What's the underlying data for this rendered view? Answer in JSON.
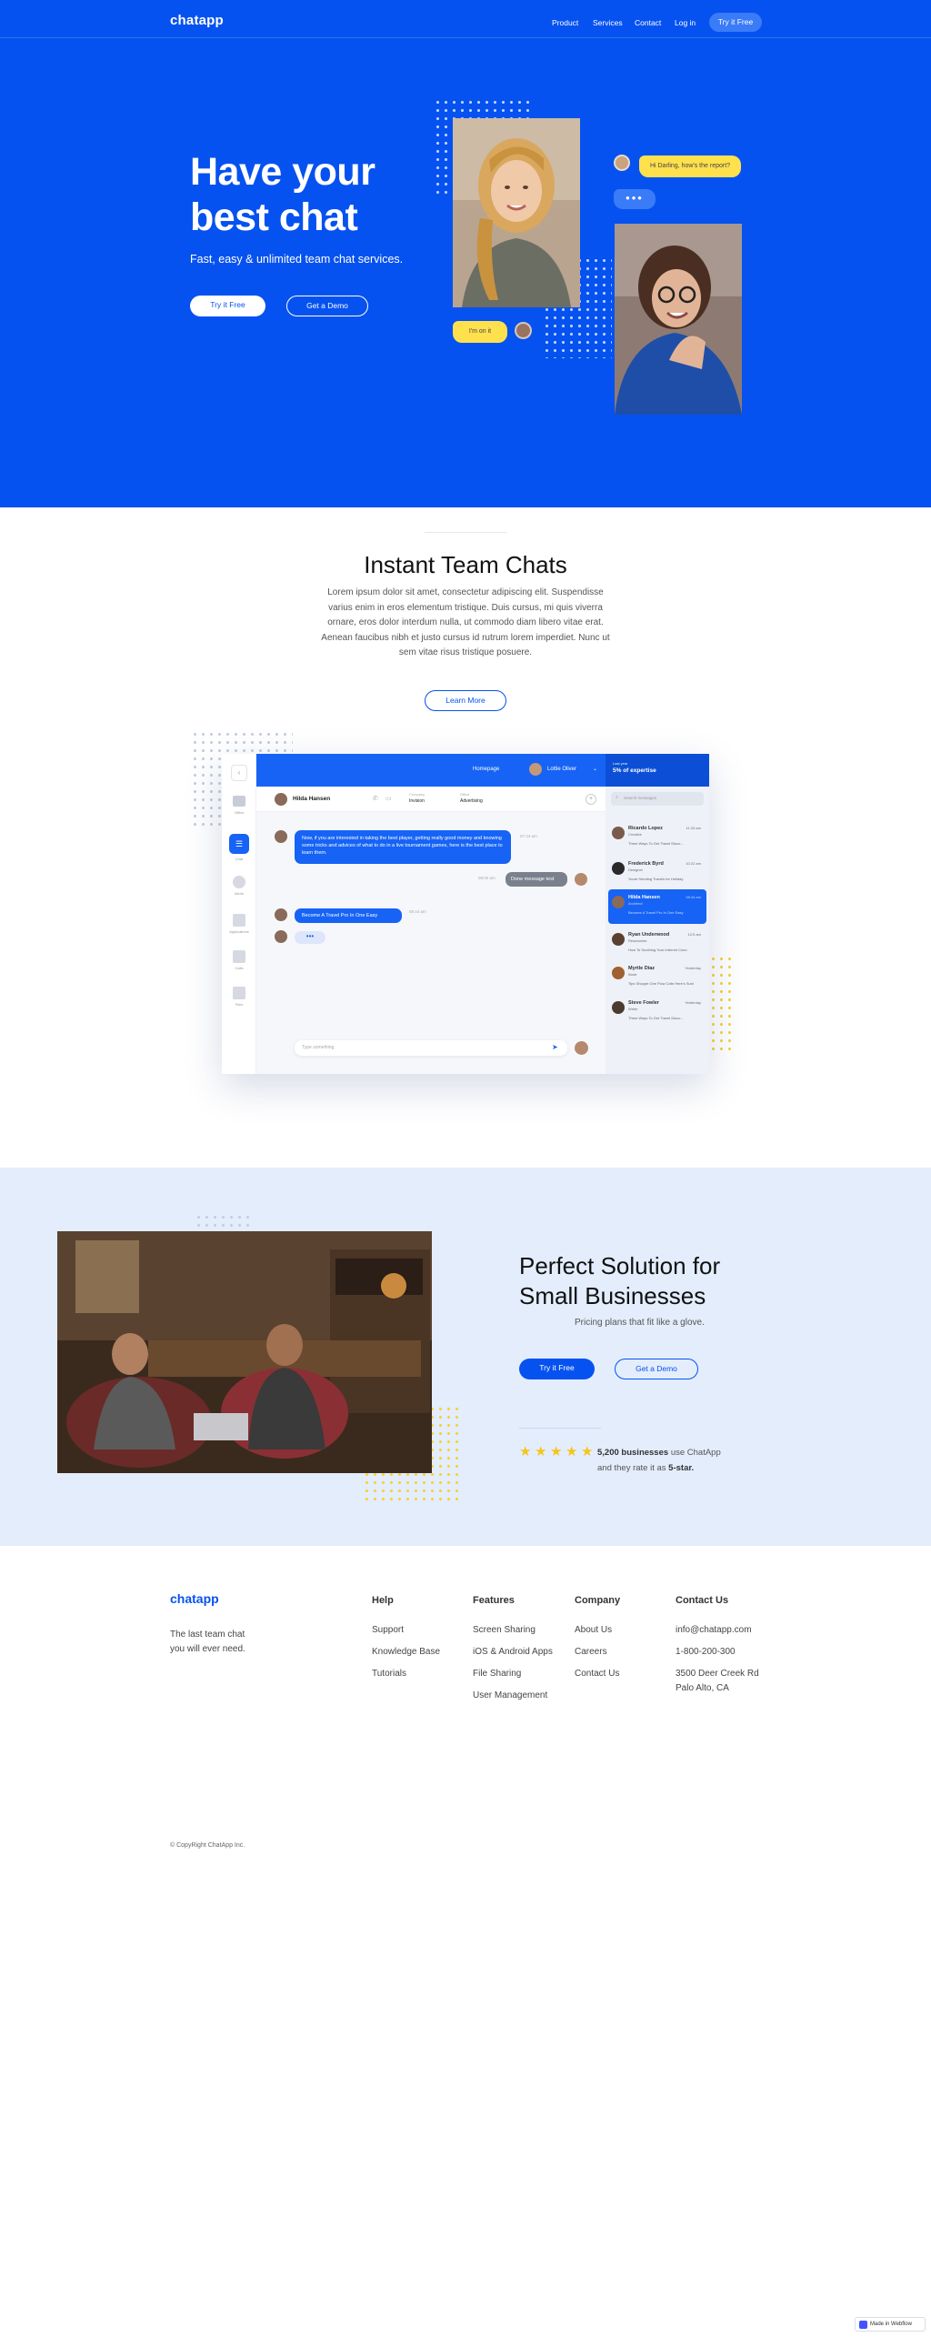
{
  "nav": {
    "logo": "chatapp",
    "links": [
      "Product",
      "Services",
      "Contact",
      "Log in"
    ],
    "cta": "Try it Free"
  },
  "hero": {
    "title": "Have your best chat",
    "subtitle": "Fast, easy & unlimited team chat services.",
    "btn_primary": "Try it Free",
    "btn_secondary": "Get a Demo",
    "bubble_1": "Hi Darling, how's the report?",
    "bubble_2": "I'm on it"
  },
  "team": {
    "title": "Instant Team Chats",
    "body": "Lorem ipsum dolor sit amet, consectetur adipiscing elit. Suspendisse varius enim in eros elementum tristique. Duis cursus, mi quis viverra ornare, eros dolor interdum nulla, ut commodo diam libero vitae erat. Aenean faucibus nibh et justo cursus id rutrum lorem imperdiet. Nunc ut sem vitae risus tristique posuere.",
    "btn": "Learn More"
  },
  "mock": {
    "top": {
      "homepage": "Homepage",
      "user": "Lottie Oliver",
      "stat_label": "Last year",
      "stat_value": "5% of expertise"
    },
    "side_labels": [
      "Office",
      "Chat",
      "Alerts",
      "Applications",
      "Calls",
      "Files"
    ],
    "chat_head": {
      "name": "Hilda Hansen",
      "company_label": "Company",
      "company": "Invision",
      "office_label": "Office",
      "office": "Advertising"
    },
    "messages": [
      {
        "text": "Now, if you are interested in taking the best player, getting really good money and knowing some tricks and advices of what to do in a live tournament games, here is the best place to learn them.",
        "time": "07:44 am"
      },
      {
        "text": "Done message test",
        "time": "08:00 am"
      },
      {
        "text": "Become A Travel Pro In One Easy",
        "time": "08:44 am"
      }
    ],
    "input_placeholder": "Type something",
    "search_placeholder": "Search messages",
    "contacts": [
      {
        "name": "Ricardo Lopez",
        "role": "Creative",
        "msg": "Three Ways To Get Travel Disco...",
        "time": "11:25 am"
      },
      {
        "name": "Frederick Byrd",
        "role": "Designer",
        "msg": "Youre Sending Travels for Holiday",
        "time": "10:22 am"
      },
      {
        "name": "Hilda Hansen",
        "role": "Architect",
        "msg": "Become A Travel Pro In One Easy",
        "time": "08:44 am"
      },
      {
        "name": "Ryan Underwood",
        "role": "Researcher",
        "msg": "How To Soothing Your Internet Conn",
        "time": "12:5 am"
      },
      {
        "name": "Myrtle Diaz",
        "role": "Illustr",
        "msg": "Tips Shoppe One Flow Cafe Here's Sust",
        "time": "Yesterday"
      },
      {
        "name": "Steve Fowler",
        "role": "Writer",
        "msg": "Three Ways To Get Travel Disco...",
        "time": "Yesterday"
      }
    ]
  },
  "business": {
    "title": "Perfect Solution for Small Businesses",
    "subtitle": "Pricing plans that fit like a glove.",
    "btn_primary": "Try it Free",
    "btn_secondary": "Get a Demo",
    "rating_count": "5,200 businesses",
    "rating_text": "use ChatApp",
    "rating_text2": "and they rate it as",
    "rating_value": "5-star.",
    "stars": 5
  },
  "footer": {
    "logo": "chatapp",
    "tagline": "The last team chat you will ever need.",
    "columns": [
      {
        "title": "Help",
        "links": [
          "Support",
          "Knowledge Base",
          "Tutorials"
        ]
      },
      {
        "title": "Features",
        "links": [
          "Screen Sharing",
          "iOS & Android Apps",
          "File Sharing",
          "User Management"
        ]
      },
      {
        "title": "Company",
        "links": [
          "About Us",
          "Careers",
          "Contact Us"
        ]
      },
      {
        "title": "Contact Us",
        "links": [
          "info@chatapp.com",
          "1-800-200-300",
          "3500 Deer Creek Rd",
          "Palo Alto, CA"
        ]
      }
    ],
    "copyright": "© CopyRight ChatApp Inc."
  },
  "badge": "Made in Webflow",
  "colors": {
    "brand": "#0652f0",
    "accent": "#ffe14d",
    "light_bg": "#e3edfc"
  }
}
